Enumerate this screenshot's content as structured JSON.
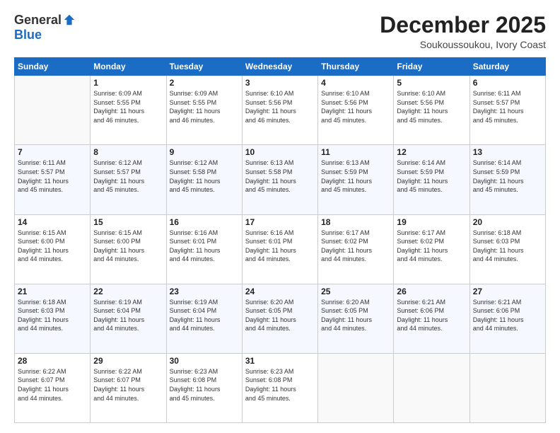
{
  "header": {
    "logo_general": "General",
    "logo_blue": "Blue",
    "month_title": "December 2025",
    "location": "Soukoussoukou, Ivory Coast"
  },
  "days_of_week": [
    "Sunday",
    "Monday",
    "Tuesday",
    "Wednesday",
    "Thursday",
    "Friday",
    "Saturday"
  ],
  "weeks": [
    [
      {
        "day": "",
        "info": ""
      },
      {
        "day": "1",
        "info": "Sunrise: 6:09 AM\nSunset: 5:55 PM\nDaylight: 11 hours\nand 46 minutes."
      },
      {
        "day": "2",
        "info": "Sunrise: 6:09 AM\nSunset: 5:55 PM\nDaylight: 11 hours\nand 46 minutes."
      },
      {
        "day": "3",
        "info": "Sunrise: 6:10 AM\nSunset: 5:56 PM\nDaylight: 11 hours\nand 46 minutes."
      },
      {
        "day": "4",
        "info": "Sunrise: 6:10 AM\nSunset: 5:56 PM\nDaylight: 11 hours\nand 45 minutes."
      },
      {
        "day": "5",
        "info": "Sunrise: 6:10 AM\nSunset: 5:56 PM\nDaylight: 11 hours\nand 45 minutes."
      },
      {
        "day": "6",
        "info": "Sunrise: 6:11 AM\nSunset: 5:57 PM\nDaylight: 11 hours\nand 45 minutes."
      }
    ],
    [
      {
        "day": "7",
        "info": "Sunrise: 6:11 AM\nSunset: 5:57 PM\nDaylight: 11 hours\nand 45 minutes."
      },
      {
        "day": "8",
        "info": "Sunrise: 6:12 AM\nSunset: 5:57 PM\nDaylight: 11 hours\nand 45 minutes."
      },
      {
        "day": "9",
        "info": "Sunrise: 6:12 AM\nSunset: 5:58 PM\nDaylight: 11 hours\nand 45 minutes."
      },
      {
        "day": "10",
        "info": "Sunrise: 6:13 AM\nSunset: 5:58 PM\nDaylight: 11 hours\nand 45 minutes."
      },
      {
        "day": "11",
        "info": "Sunrise: 6:13 AM\nSunset: 5:59 PM\nDaylight: 11 hours\nand 45 minutes."
      },
      {
        "day": "12",
        "info": "Sunrise: 6:14 AM\nSunset: 5:59 PM\nDaylight: 11 hours\nand 45 minutes."
      },
      {
        "day": "13",
        "info": "Sunrise: 6:14 AM\nSunset: 5:59 PM\nDaylight: 11 hours\nand 45 minutes."
      }
    ],
    [
      {
        "day": "14",
        "info": "Sunrise: 6:15 AM\nSunset: 6:00 PM\nDaylight: 11 hours\nand 44 minutes."
      },
      {
        "day": "15",
        "info": "Sunrise: 6:15 AM\nSunset: 6:00 PM\nDaylight: 11 hours\nand 44 minutes."
      },
      {
        "day": "16",
        "info": "Sunrise: 6:16 AM\nSunset: 6:01 PM\nDaylight: 11 hours\nand 44 minutes."
      },
      {
        "day": "17",
        "info": "Sunrise: 6:16 AM\nSunset: 6:01 PM\nDaylight: 11 hours\nand 44 minutes."
      },
      {
        "day": "18",
        "info": "Sunrise: 6:17 AM\nSunset: 6:02 PM\nDaylight: 11 hours\nand 44 minutes."
      },
      {
        "day": "19",
        "info": "Sunrise: 6:17 AM\nSunset: 6:02 PM\nDaylight: 11 hours\nand 44 minutes."
      },
      {
        "day": "20",
        "info": "Sunrise: 6:18 AM\nSunset: 6:03 PM\nDaylight: 11 hours\nand 44 minutes."
      }
    ],
    [
      {
        "day": "21",
        "info": "Sunrise: 6:18 AM\nSunset: 6:03 PM\nDaylight: 11 hours\nand 44 minutes."
      },
      {
        "day": "22",
        "info": "Sunrise: 6:19 AM\nSunset: 6:04 PM\nDaylight: 11 hours\nand 44 minutes."
      },
      {
        "day": "23",
        "info": "Sunrise: 6:19 AM\nSunset: 6:04 PM\nDaylight: 11 hours\nand 44 minutes."
      },
      {
        "day": "24",
        "info": "Sunrise: 6:20 AM\nSunset: 6:05 PM\nDaylight: 11 hours\nand 44 minutes."
      },
      {
        "day": "25",
        "info": "Sunrise: 6:20 AM\nSunset: 6:05 PM\nDaylight: 11 hours\nand 44 minutes."
      },
      {
        "day": "26",
        "info": "Sunrise: 6:21 AM\nSunset: 6:06 PM\nDaylight: 11 hours\nand 44 minutes."
      },
      {
        "day": "27",
        "info": "Sunrise: 6:21 AM\nSunset: 6:06 PM\nDaylight: 11 hours\nand 44 minutes."
      }
    ],
    [
      {
        "day": "28",
        "info": "Sunrise: 6:22 AM\nSunset: 6:07 PM\nDaylight: 11 hours\nand 44 minutes."
      },
      {
        "day": "29",
        "info": "Sunrise: 6:22 AM\nSunset: 6:07 PM\nDaylight: 11 hours\nand 44 minutes."
      },
      {
        "day": "30",
        "info": "Sunrise: 6:23 AM\nSunset: 6:08 PM\nDaylight: 11 hours\nand 45 minutes."
      },
      {
        "day": "31",
        "info": "Sunrise: 6:23 AM\nSunset: 6:08 PM\nDaylight: 11 hours\nand 45 minutes."
      },
      {
        "day": "",
        "info": ""
      },
      {
        "day": "",
        "info": ""
      },
      {
        "day": "",
        "info": ""
      }
    ]
  ]
}
